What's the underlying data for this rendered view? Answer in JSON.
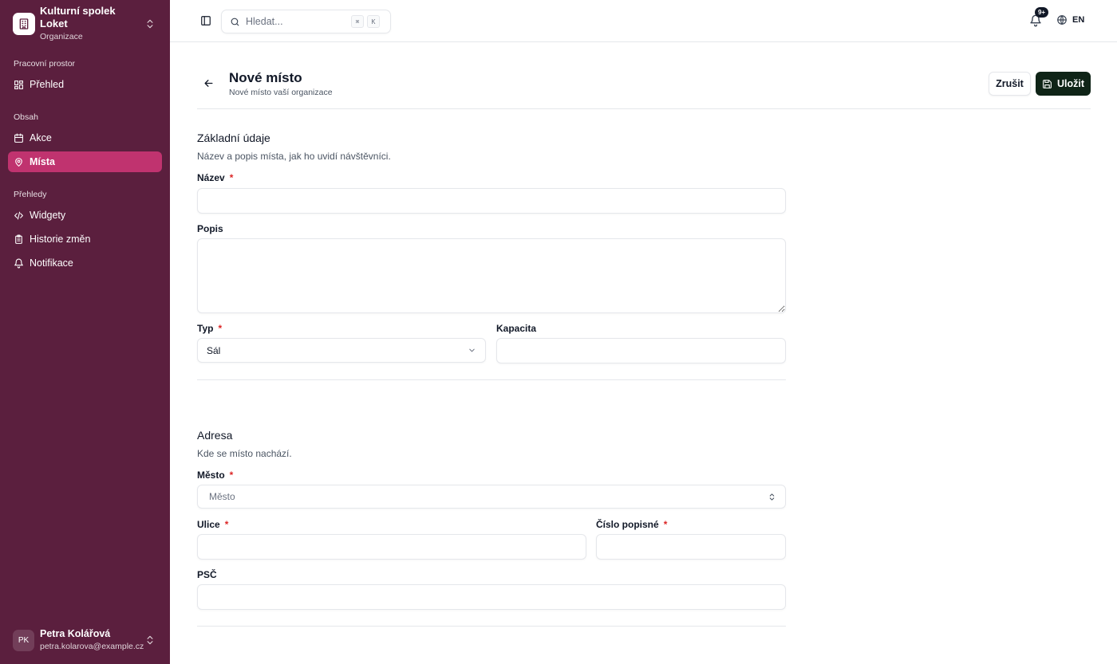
{
  "org": {
    "name": "Kulturní spolek Loket",
    "subtitle": "Organizace"
  },
  "sidebar": {
    "sections": [
      {
        "label": "Pracovní prostor"
      },
      {
        "label": "Obsah"
      },
      {
        "label": "Přehledy"
      }
    ],
    "items": [
      {
        "label": "Přehled",
        "icon": "dashboard-icon"
      },
      {
        "label": "Akce",
        "icon": "calendar-icon"
      },
      {
        "label": "Místa",
        "icon": "map-pin-icon",
        "active": true
      },
      {
        "label": "Widgety",
        "icon": "code-icon"
      },
      {
        "label": "Historie změn",
        "icon": "clipboard-icon"
      },
      {
        "label": "Notifikace",
        "icon": "bell-icon"
      }
    ]
  },
  "user": {
    "initials": "PK",
    "name": "Petra Kolářová",
    "email": "petra.kolarova@example.cz"
  },
  "topbar": {
    "search_placeholder": "Hledat...",
    "shortcut_keys": [
      "⌘",
      "K"
    ],
    "notifications_badge": "9+",
    "language": "EN"
  },
  "page": {
    "title": "Nové místo",
    "subtitle": "Nové místo vaší organizace",
    "cancel_label": "Zrušit",
    "save_label": "Uložit"
  },
  "form": {
    "basic": {
      "title": "Základní údaje",
      "description": "Název a popis místa, jak ho uvidí návštěvníci.",
      "name_label": "Název",
      "description_label": "Popis",
      "type_label": "Typ",
      "type_value": "Sál",
      "capacity_label": "Kapacita"
    },
    "address": {
      "title": "Adresa",
      "description": "Kde se místo nachází.",
      "city_label": "Město",
      "city_placeholder": "Město",
      "street_label": "Ulice",
      "house_number_label": "Číslo popisné",
      "zip_label": "PSČ"
    },
    "required_marker": "*"
  },
  "colors": {
    "sidebar_bg": "#5b1f3e",
    "active_item": "#c0336f",
    "primary_button": "#0f2417",
    "required": "#dc2626"
  }
}
